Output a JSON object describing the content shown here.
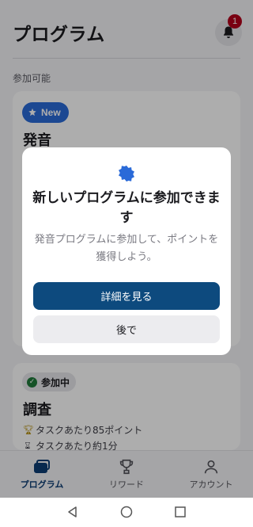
{
  "header": {
    "title": "プログラム",
    "notification_count": "1"
  },
  "section_label": "参加可能",
  "cards": [
    {
      "badge": "New",
      "title": "発音"
    },
    {
      "badge": "参加中",
      "title": "調査",
      "details": [
        "タスクあたり85ポイント",
        "タスクあたり約1分"
      ]
    }
  ],
  "dialog": {
    "title": "新しいプログラムに参加できます",
    "body": "発音プログラムに参加して、ポイントを獲得しよう。",
    "primary_label": "詳細を見る",
    "secondary_label": "後で"
  },
  "bottom_nav": [
    {
      "label": "プログラム",
      "icon": "programs-icon",
      "active": true
    },
    {
      "label": "リワード",
      "icon": "trophy-icon",
      "active": false
    },
    {
      "label": "アカウント",
      "icon": "person-icon",
      "active": false
    }
  ],
  "colors": {
    "accent": "#0d4a7e",
    "badge_new": "#2a6ad8",
    "notification": "#b3001b",
    "joined_check": "#1f7a3a"
  }
}
